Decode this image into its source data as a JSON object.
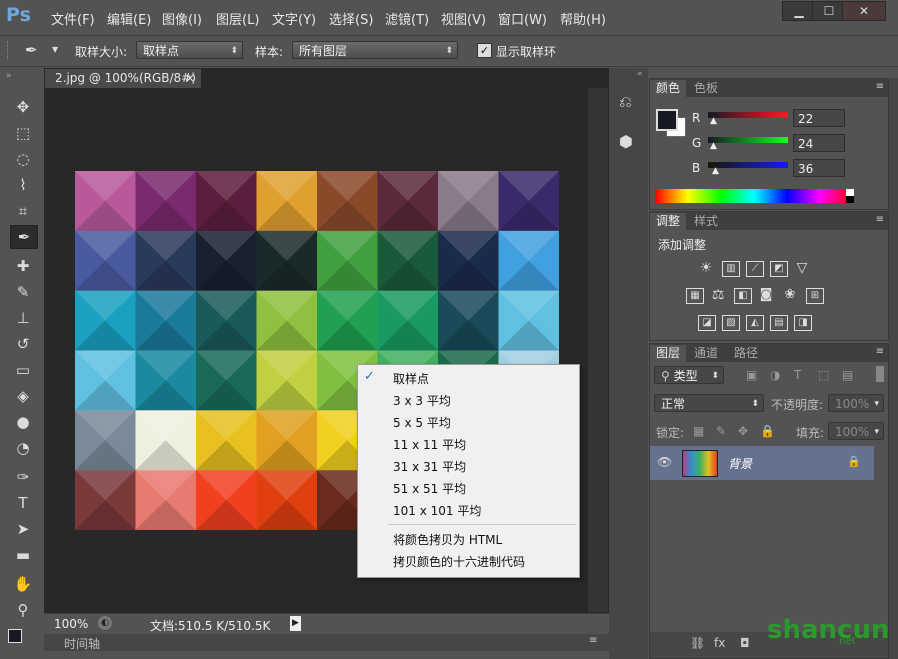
{
  "app": {
    "logo": "Ps"
  },
  "menu": [
    "文件(F)",
    "编辑(E)",
    "图像(I)",
    "图层(L)",
    "文字(Y)",
    "选择(S)",
    "滤镜(T)",
    "视图(V)",
    "窗口(W)",
    "帮助(H)"
  ],
  "window_controls": {
    "minimize": "▁",
    "maximize": "☐",
    "close": "✕"
  },
  "options": {
    "sample_size_label": "取样大小:",
    "sample_size_value": "取样点",
    "sample_label": "样本:",
    "sample_value": "所有图层",
    "show_ring_label": "显示取样环",
    "show_ring_checked": true
  },
  "document": {
    "tab_title": "2.jpg @ 100%(RGB/8#)",
    "tab_close": "×",
    "zoom": "100%",
    "doc_info": "文档:510.5 K/510.5K",
    "timeline_label": "时间轴"
  },
  "context_menu": {
    "checked_index": 0,
    "check_glyph": "✓",
    "items": [
      "取样点",
      "3 x 3 平均",
      "5 x 5 平均",
      "11 x 11 平均",
      "31 x 31 平均",
      "51 x 51 平均",
      "101 x 101 平均"
    ],
    "extra_items": [
      "将颜色拷贝为 HTML",
      "拷贝颜色的十六进制代码"
    ]
  },
  "color_panel": {
    "tabs": [
      "颜色",
      "色板"
    ],
    "channels": [
      {
        "label": "R",
        "value": "22",
        "color": "#e02020"
      },
      {
        "label": "G",
        "value": "24",
        "color": "#20c040"
      },
      {
        "label": "B",
        "value": "36",
        "color": "#2030d0"
      }
    ],
    "foreground": "#161824"
  },
  "adjustments_panel": {
    "tabs": [
      "调整",
      "样式"
    ],
    "title": "添加调整"
  },
  "layers_panel": {
    "tabs": [
      "图层",
      "通道",
      "路径"
    ],
    "kind_label": "类型",
    "blend_mode": "正常",
    "opacity_label": "不透明度:",
    "opacity_value": "100%",
    "lock_label": "锁定:",
    "fill_label": "填充:",
    "fill_value": "100%",
    "layers": [
      {
        "name": "背景",
        "locked": true
      }
    ]
  },
  "watermark": {
    "text": "shancun",
    "sub": ".net"
  }
}
